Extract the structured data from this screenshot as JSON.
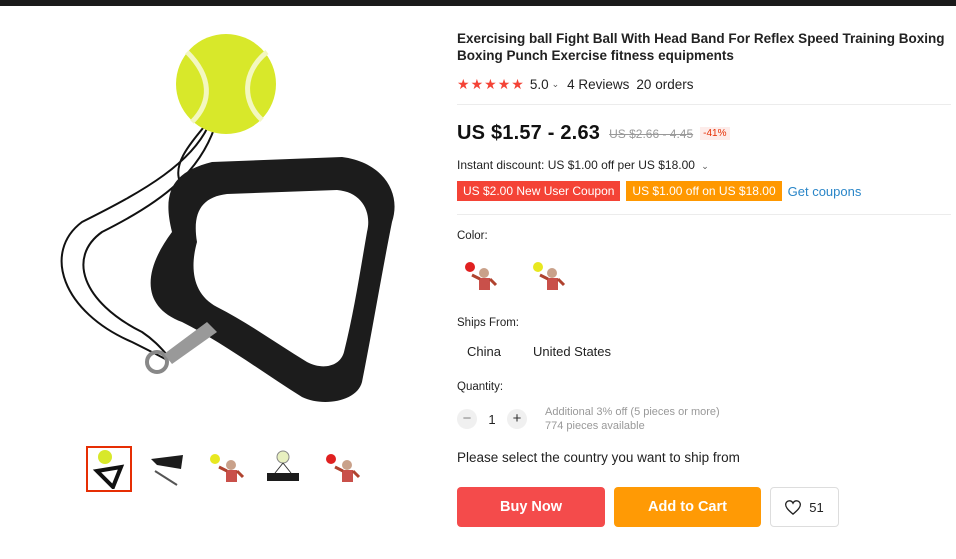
{
  "product": {
    "title": "Exercising ball Fight Ball With Head Band For Reflex Speed Training Boxing Boxing Punch Exercise fitness equipments",
    "rating": "5.0",
    "reviews": "4 Reviews",
    "orders": "20 orders",
    "stars": 5
  },
  "price": {
    "current": "US $1.57 - 2.63",
    "original": "US $2.66 - 4.45",
    "discount": "-41%"
  },
  "instant_discount": "Instant discount: US $1.00 off per US $18.00",
  "coupons": {
    "new_user": "US $2.00 New User Coupon",
    "off": "US $1.00 off on US $18.00",
    "get_label": "Get coupons"
  },
  "color": {
    "label": "Color:",
    "options": [
      "red-ball-boxer-icon",
      "yellow-ball-boxer-icon"
    ]
  },
  "ships_from": {
    "label": "Ships From:",
    "options": [
      "China",
      "United States"
    ]
  },
  "quantity": {
    "label": "Quantity:",
    "value": "1",
    "minus": "−",
    "plus": "+",
    "offer": "Additional 3% off (5 pieces or more)",
    "available": "774 pieces available"
  },
  "ship_note": "Please select the country you want to ship from",
  "actions": {
    "buy_now": "Buy Now",
    "add_to_cart": "Add to Cart",
    "wishlist_count": "51"
  },
  "colors": {
    "red": "#f44336",
    "orange": "#ff9800",
    "link": "#2a86c8",
    "ball": "#d8e82a"
  }
}
